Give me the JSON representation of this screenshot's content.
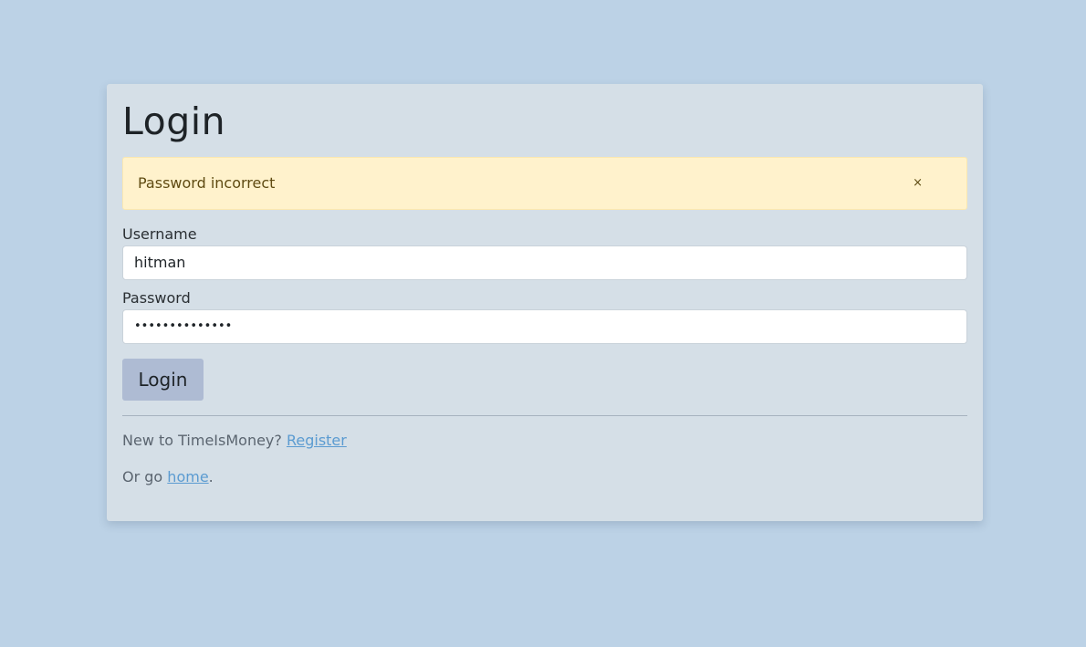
{
  "login": {
    "title": "Login",
    "alert": {
      "message": "Password incorrect",
      "close_glyph": "×"
    },
    "username": {
      "label": "Username",
      "value": "hitman"
    },
    "password": {
      "label": "Password",
      "masked_value": "••••••••••••••"
    },
    "submit_label": "Login",
    "register": {
      "prefix": "New to TimeIsMoney? ",
      "link_text": "Register"
    },
    "home": {
      "prefix": "Or go ",
      "link_text": "home",
      "suffix": "."
    }
  },
  "colors": {
    "background": "#bcd2e6",
    "card": "#d5dfe7",
    "alert_background": "#fff2cc",
    "button": "#aebbd3",
    "link": "#5b9bd1"
  },
  "icons": {
    "alert_close": "close-icon"
  }
}
